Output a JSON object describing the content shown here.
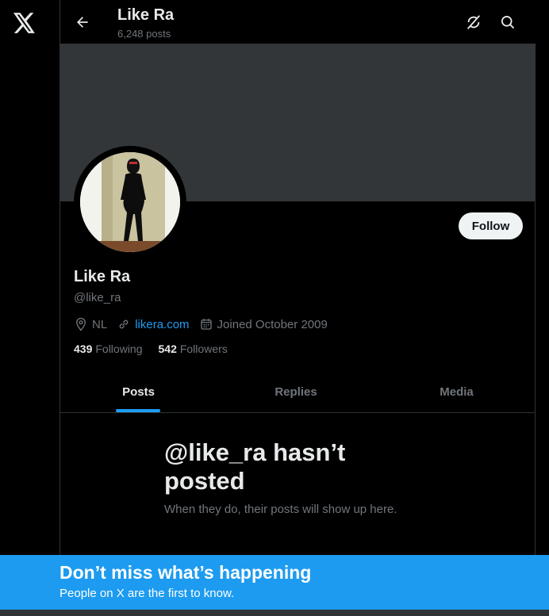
{
  "icons": {
    "logo": "x-logo-icon",
    "back": "arrow-left-icon",
    "refresh": "refresh-icon",
    "search": "search-icon",
    "location": "location-pin-icon",
    "link": "link-icon",
    "calendar": "calendar-icon"
  },
  "header": {
    "name": "Like Ra",
    "post_count": "6,248 posts"
  },
  "profile": {
    "name": "Like Ra",
    "handle": "@like_ra",
    "follow_label": "Follow",
    "location": "NL",
    "website": "likera.com",
    "joined": "Joined October 2009",
    "following_count": "439",
    "following_label": "Following",
    "followers_count": "542",
    "followers_label": "Followers"
  },
  "tabs": [
    {
      "label": "Posts",
      "active": true
    },
    {
      "label": "Replies",
      "active": false
    },
    {
      "label": "Media",
      "active": false
    }
  ],
  "empty_state": {
    "title": "@like_ra hasn’t posted",
    "subtitle": "When they do, their posts will show up here."
  },
  "cta": {
    "title": "Don’t miss what’s happening",
    "subtitle": "People on X are the first to know."
  },
  "colors": {
    "accent": "#1d9bf0",
    "background": "#000000",
    "banner": "#333639",
    "muted": "#71767b"
  }
}
